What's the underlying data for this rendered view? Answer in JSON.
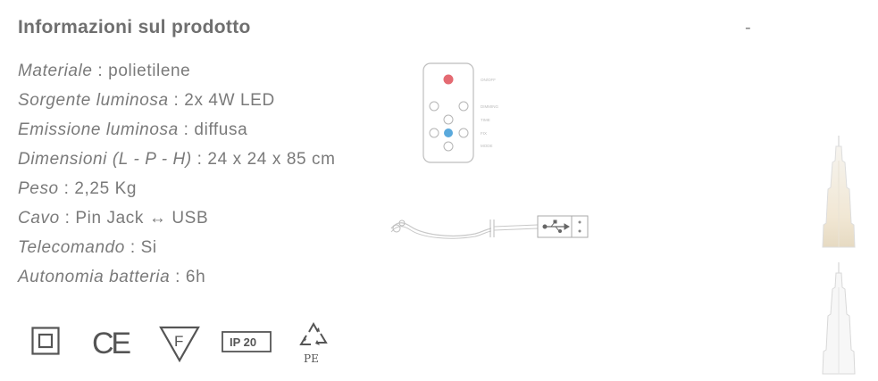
{
  "product_info": {
    "title": "Informazioni sul prodotto",
    "collapse_label": "-",
    "specs": [
      {
        "key": "Materiale",
        "value": " : polietilene"
      },
      {
        "key": "Sorgente luminosa",
        "value": " : 2x 4W LED"
      },
      {
        "key": "Emissione luminosa",
        "value": " : diffusa"
      },
      {
        "key": "Dimensioni (L - P - H)",
        "value": " : 24 x 24 x 85 cm"
      },
      {
        "key": "Peso",
        "value": " : 2,25 Kg"
      },
      {
        "key": "Cavo",
        "value": " : Pin Jack ↔ USB"
      },
      {
        "key": "Telecomando",
        "value": " : Si"
      },
      {
        "key": "Autonomia batteria",
        "value": " : 6h"
      }
    ]
  },
  "remote": {
    "labels": [
      "ON/OFF",
      "DIMMING",
      "TIME",
      "FIX",
      "MODE"
    ]
  },
  "certifications": {
    "ip_text": "IP 20",
    "ce_text": "CE",
    "f_text": "F",
    "recycle_text": "PE"
  },
  "colors": {
    "remote_power_button": "#e46a72",
    "remote_center_button": "#5aa9dc",
    "text": "#7a7a7a"
  }
}
